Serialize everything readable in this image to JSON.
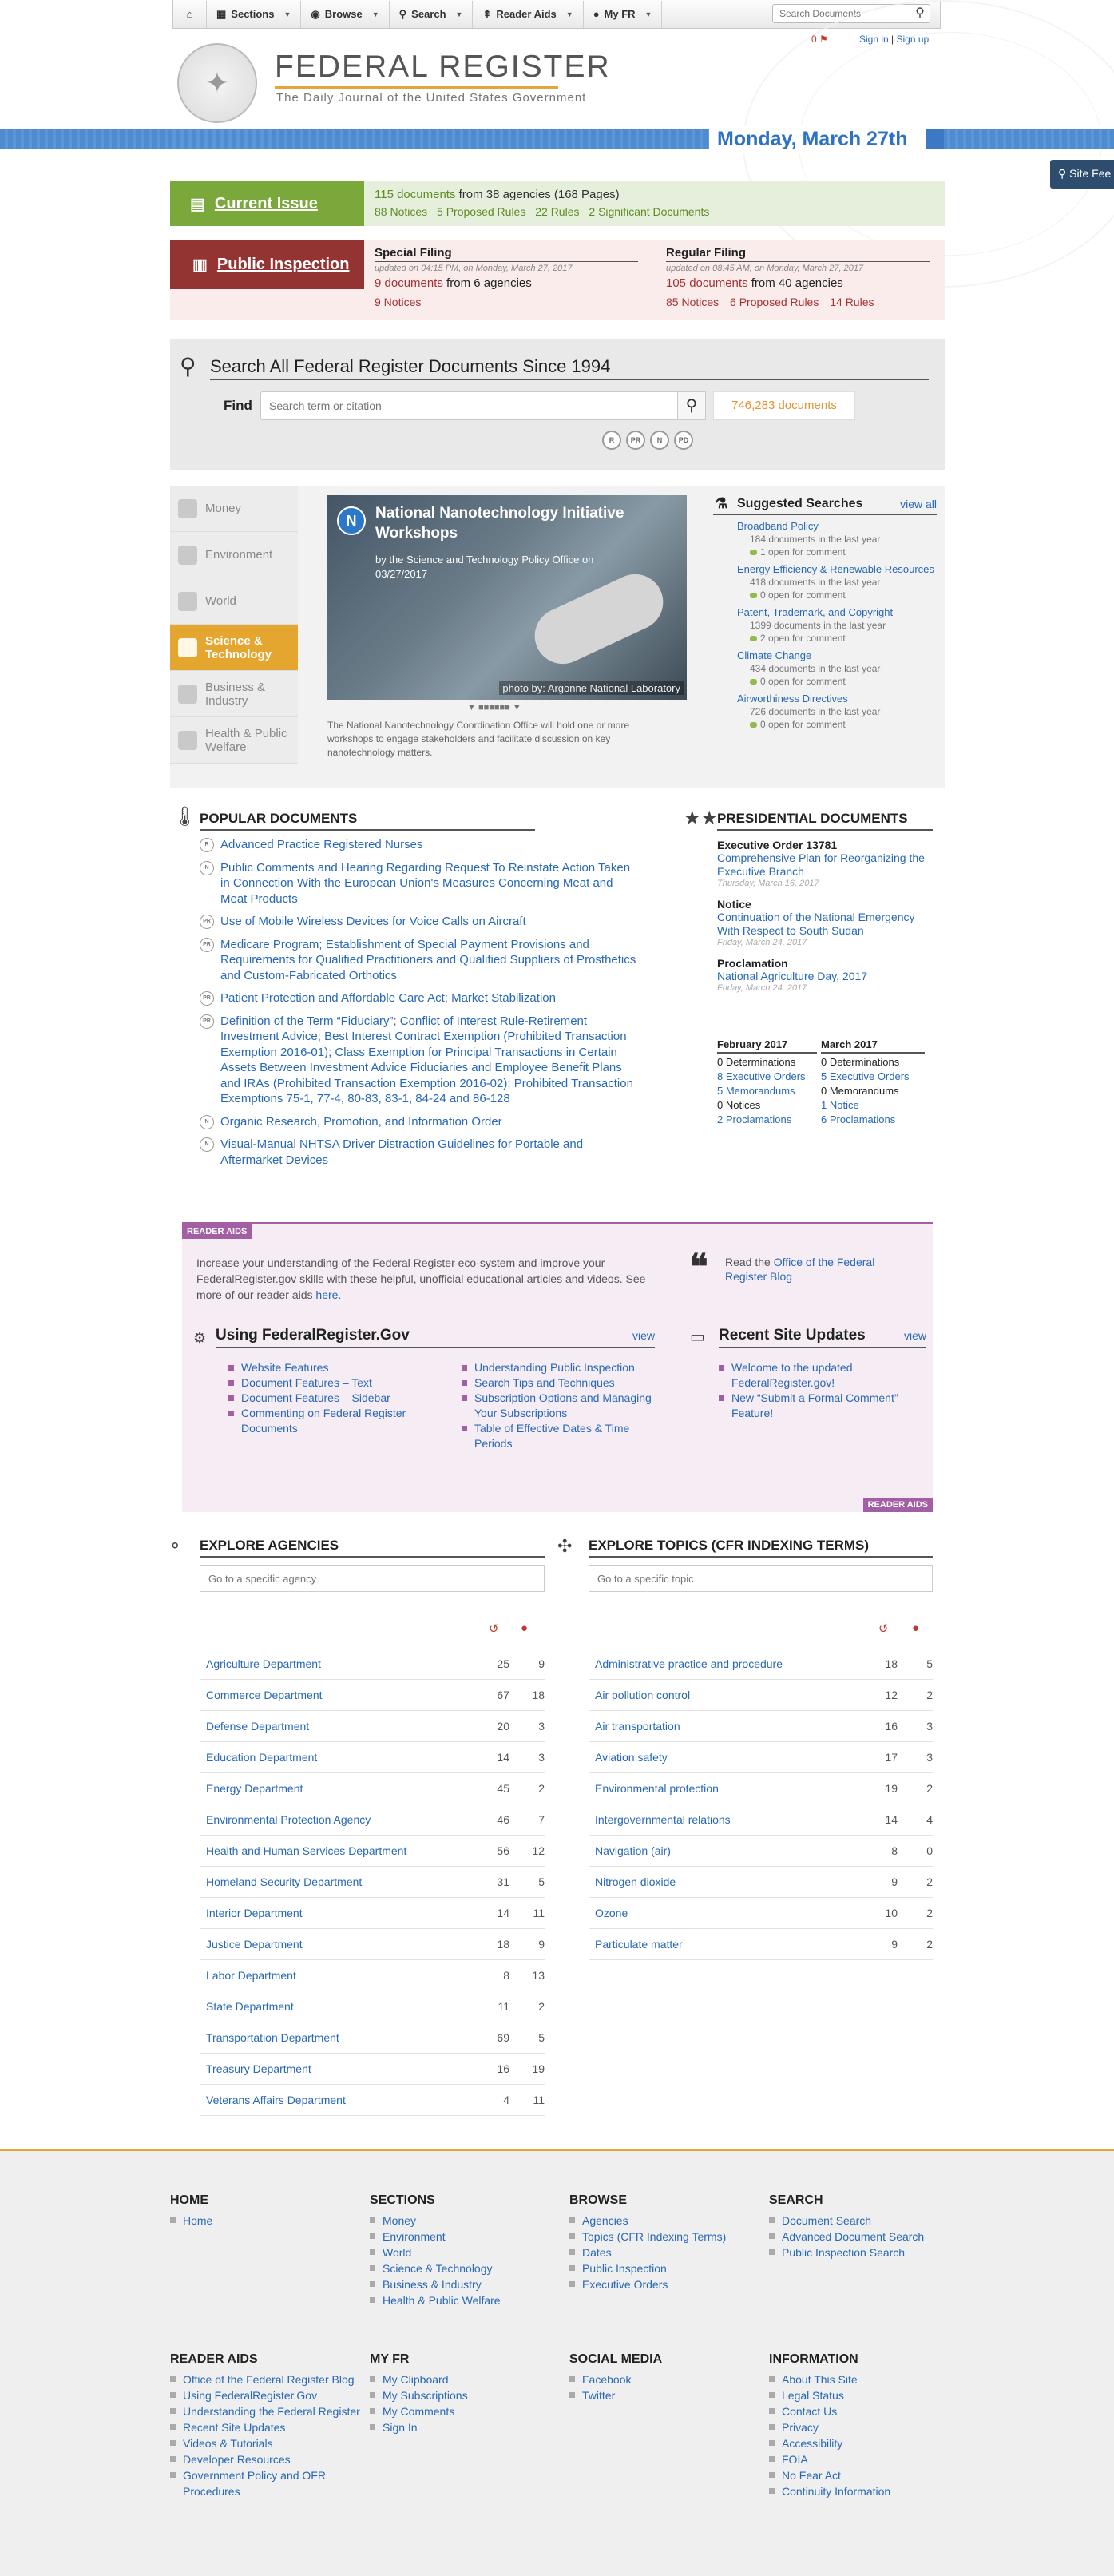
{
  "nav": {
    "home_icon": "home-icon",
    "items": [
      {
        "label": "Sections",
        "icon": "sections-icon"
      },
      {
        "label": "Browse",
        "icon": "eye-icon"
      },
      {
        "label": "Search",
        "icon": "search-icon"
      },
      {
        "label": "Reader Aids",
        "icon": "signpost-icon"
      },
      {
        "label": "My FR",
        "icon": "user-icon"
      }
    ],
    "search_placeholder": "Search Documents"
  },
  "header": {
    "title": "FEDERAL REGISTER",
    "subtitle": "The Daily Journal of the United States Government",
    "notifications": "0",
    "sign_in": "Sign in",
    "sign_up": "Sign up",
    "date": "Monday, March 27th",
    "site_feedback": "Site Fee"
  },
  "current_issue": {
    "label": "Current Issue",
    "docs": "115 documents",
    "docs_rest": " from 38 agencies (168 Pages)",
    "counts": [
      "88 Notices",
      "5 Proposed Rules",
      "22 Rules",
      "2 Significant Documents"
    ]
  },
  "public_inspection": {
    "label": "Public Inspection",
    "special": {
      "title": "Special Filing",
      "updated": "updated on 04:15 PM, on Monday, March 27, 2017",
      "docs": "9 documents",
      "docs_rest": " from 6 agencies",
      "counts": [
        "9 Notices"
      ]
    },
    "regular": {
      "title": "Regular Filing",
      "updated": "updated on 08:45 AM, on Monday, March 27, 2017",
      "docs": "105 documents",
      "docs_rest": " from 40 agencies",
      "counts": [
        "85 Notices",
        "6 Proposed Rules",
        "14 Rules"
      ]
    }
  },
  "search": {
    "title": "Search All Federal Register Documents Since 1994",
    "find_label": "Find",
    "placeholder": "Search term or citation",
    "count": "746,283 documents",
    "doc_types": [
      "R",
      "PR",
      "N",
      "PD"
    ]
  },
  "sections": {
    "items": [
      "Money",
      "Environment",
      "World",
      "Science & Technology",
      "Business & Industry",
      "Health & Public Welfare"
    ],
    "active": "Science & Technology",
    "featured": {
      "badge": "N",
      "title": "National Nanotechnology Initiative Workshops",
      "byline": "by the Science and Technology Policy Office on 03/27/2017",
      "credit": "photo by: Argonne National Laboratory",
      "description": "The National Nanotechnology Coordination Office will hold one or more workshops to engage stakeholders and facilitate discussion on key nanotechnology matters."
    },
    "suggested": {
      "title": "Suggested Searches",
      "view_all": "view all",
      "items": [
        {
          "name": "Broadband Policy",
          "count": "184 documents in the last year",
          "open": "1 open for comment"
        },
        {
          "name": "Energy Efficiency & Renewable Resources",
          "count": "418 documents in the last year",
          "open": "0 open for comment"
        },
        {
          "name": "Patent, Trademark, and Copyright",
          "count": "1399 documents in the last year",
          "open": "2 open for comment"
        },
        {
          "name": "Climate Change",
          "count": "434 documents in the last year",
          "open": "0 open for comment"
        },
        {
          "name": "Airworthiness Directives",
          "count": "726 documents in the last year",
          "open": "0 open for comment"
        }
      ]
    }
  },
  "popular": {
    "title": "POPULAR DOCUMENTS",
    "items": [
      {
        "type": "R",
        "title": "Advanced Practice Registered Nurses"
      },
      {
        "type": "N",
        "title": "Public Comments and Hearing Regarding Request To Reinstate Action Taken in Connection With the European Union's Measures Concerning Meat and Meat Products"
      },
      {
        "type": "PR",
        "title": "Use of Mobile Wireless Devices for Voice Calls on Aircraft"
      },
      {
        "type": "PR",
        "title": "Medicare Program; Establishment of Special Payment Provisions and Requirements for Qualified Practitioners and Qualified Suppliers of Prosthetics and Custom-Fabricated Orthotics"
      },
      {
        "type": "PR",
        "title": "Patient Protection and Affordable Care Act; Market Stabilization"
      },
      {
        "type": "PR",
        "title": "Definition of the Term “Fiduciary”; Conflict of Interest Rule-Retirement Investment Advice; Best Interest Contract Exemption (Prohibited Transaction Exemption 2016-01); Class Exemption for Principal Transactions in Certain Assets Between Investment Advice Fiduciaries and Employee Benefit Plans and IRAs (Prohibited Transaction Exemption 2016-02); Prohibited Transaction Exemptions 75-1, 77-4, 80-83, 83-1, 84-24 and 86-128"
      },
      {
        "type": "N",
        "title": "Organic Research, Promotion, and Information Order"
      },
      {
        "type": "N",
        "title": "Visual-Manual NHTSA Driver Distraction Guidelines for Portable and Aftermarket Devices"
      }
    ]
  },
  "presidential": {
    "title": "PRESIDENTIAL DOCUMENTS",
    "items": [
      {
        "type": "Executive Order 13781",
        "title": "Comprehensive Plan for Reorganizing the Executive Branch",
        "date": "Thursday, March 16, 2017"
      },
      {
        "type": "Notice",
        "title": "Continuation of the National Emergency With Respect to South Sudan",
        "date": "Friday, March 24, 2017"
      },
      {
        "type": "Proclamation",
        "title": "National Agriculture Day, 2017",
        "date": "Friday, March 24, 2017"
      }
    ],
    "months": [
      {
        "name": "February 2017",
        "rows": [
          "0 Determinations",
          "8 Executive Orders",
          "5 Memorandums",
          "0 Notices",
          "2 Proclamations"
        ]
      },
      {
        "name": "March 2017",
        "rows": [
          "0 Determinations",
          "5 Executive Orders",
          "0 Memorandums",
          "1 Notice",
          "6 Proclamations"
        ]
      }
    ]
  },
  "reader_aids": {
    "tag": "READER AIDS",
    "intro": "Increase your understanding of the Federal Register eco-system and improve your FederalRegister.gov skills with these helpful, unofficial educational articles and videos. See more of our reader aids",
    "intro_link": "here.",
    "read_prefix": "Read the",
    "read_link": "Office of the Federal Register Blog",
    "using": {
      "title": "Using FederalRegister.Gov",
      "view": "view",
      "col1": [
        "Website Features",
        "Document Features – Text",
        "Document Features – Sidebar",
        "Commenting on Federal Register Documents"
      ],
      "col2": [
        "Understanding Public Inspection",
        "Search Tips and Techniques",
        "Subscription Options and Managing Your Subscriptions",
        "Table of Effective Dates & Time Periods"
      ]
    },
    "updates": {
      "title": "Recent Site Updates",
      "view": "view",
      "items": [
        "Welcome to the updated FederalRegister.gov!",
        "New “Submit a Formal Comment” Feature!"
      ]
    }
  },
  "agencies": {
    "title": "EXPLORE AGENCIES",
    "placeholder": "Go to a specific agency",
    "rows": [
      [
        "Agriculture Department",
        "25",
        "9"
      ],
      [
        "Commerce Department",
        "67",
        "18"
      ],
      [
        "Defense Department",
        "20",
        "3"
      ],
      [
        "Education Department",
        "14",
        "3"
      ],
      [
        "Energy Department",
        "45",
        "2"
      ],
      [
        "Environmental Protection Agency",
        "46",
        "7"
      ],
      [
        "Health and Human Services Department",
        "56",
        "12"
      ],
      [
        "Homeland Security Department",
        "31",
        "5"
      ],
      [
        "Interior Department",
        "14",
        "11"
      ],
      [
        "Justice Department",
        "18",
        "9"
      ],
      [
        "Labor Department",
        "8",
        "13"
      ],
      [
        "State Department",
        "11",
        "2"
      ],
      [
        "Transportation Department",
        "69",
        "5"
      ],
      [
        "Treasury Department",
        "16",
        "19"
      ],
      [
        "Veterans Affairs Department",
        "4",
        "11"
      ]
    ]
  },
  "topics": {
    "title": "EXPLORE TOPICS (CFR INDEXING TERMS)",
    "placeholder": "Go to a specific topic",
    "rows": [
      [
        "Administrative practice and procedure",
        "18",
        "5"
      ],
      [
        "Air pollution control",
        "12",
        "2"
      ],
      [
        "Air transportation",
        "16",
        "3"
      ],
      [
        "Aviation safety",
        "17",
        "3"
      ],
      [
        "Environmental protection",
        "19",
        "2"
      ],
      [
        "Intergovernmental relations",
        "14",
        "4"
      ],
      [
        "Navigation (air)",
        "8",
        "0"
      ],
      [
        "Nitrogen dioxide",
        "9",
        "2"
      ],
      [
        "Ozone",
        "10",
        "2"
      ],
      [
        "Particulate matter",
        "9",
        "2"
      ]
    ]
  },
  "footer": {
    "columns": [
      {
        "title": "HOME",
        "items": [
          "Home"
        ]
      },
      {
        "title": "SECTIONS",
        "items": [
          "Money",
          "Environment",
          "World",
          "Science & Technology",
          "Business & Industry",
          "Health & Public Welfare"
        ]
      },
      {
        "title": "BROWSE",
        "items": [
          "Agencies",
          "Topics (CFR Indexing Terms)",
          "Dates",
          "Public Inspection",
          "Executive Orders"
        ]
      },
      {
        "title": "SEARCH",
        "items": [
          "Document Search",
          "Advanced Document Search",
          "Public Inspection Search"
        ]
      },
      {
        "title": "READER AIDS",
        "items": [
          "Office of the Federal Register Blog",
          "Using FederalRegister.Gov",
          "Understanding the Federal Register",
          "Recent Site Updates",
          "Videos & Tutorials",
          "Developer Resources",
          "Government Policy and OFR Procedures"
        ]
      },
      {
        "title": "MY FR",
        "items": [
          "My Clipboard",
          "My Subscriptions",
          "My Comments",
          "Sign In"
        ]
      },
      {
        "title": "SOCIAL MEDIA",
        "items": [
          "Facebook",
          "Twitter"
        ]
      },
      {
        "title": "INFORMATION",
        "items": [
          "About This Site",
          "Legal Status",
          "Contact Us",
          "Privacy",
          "Accessibility",
          "FOIA",
          "No Fear Act",
          "Continuity Information"
        ]
      }
    ]
  },
  "colors": {
    "accent_blue": "#2868b6",
    "current_issue_green": "#7ba83b",
    "public_inspection_red": "#943432",
    "science_orange": "#e4a62e",
    "reader_aids_purple": "#a35fa3",
    "footer_rule": "#e6a43a"
  }
}
